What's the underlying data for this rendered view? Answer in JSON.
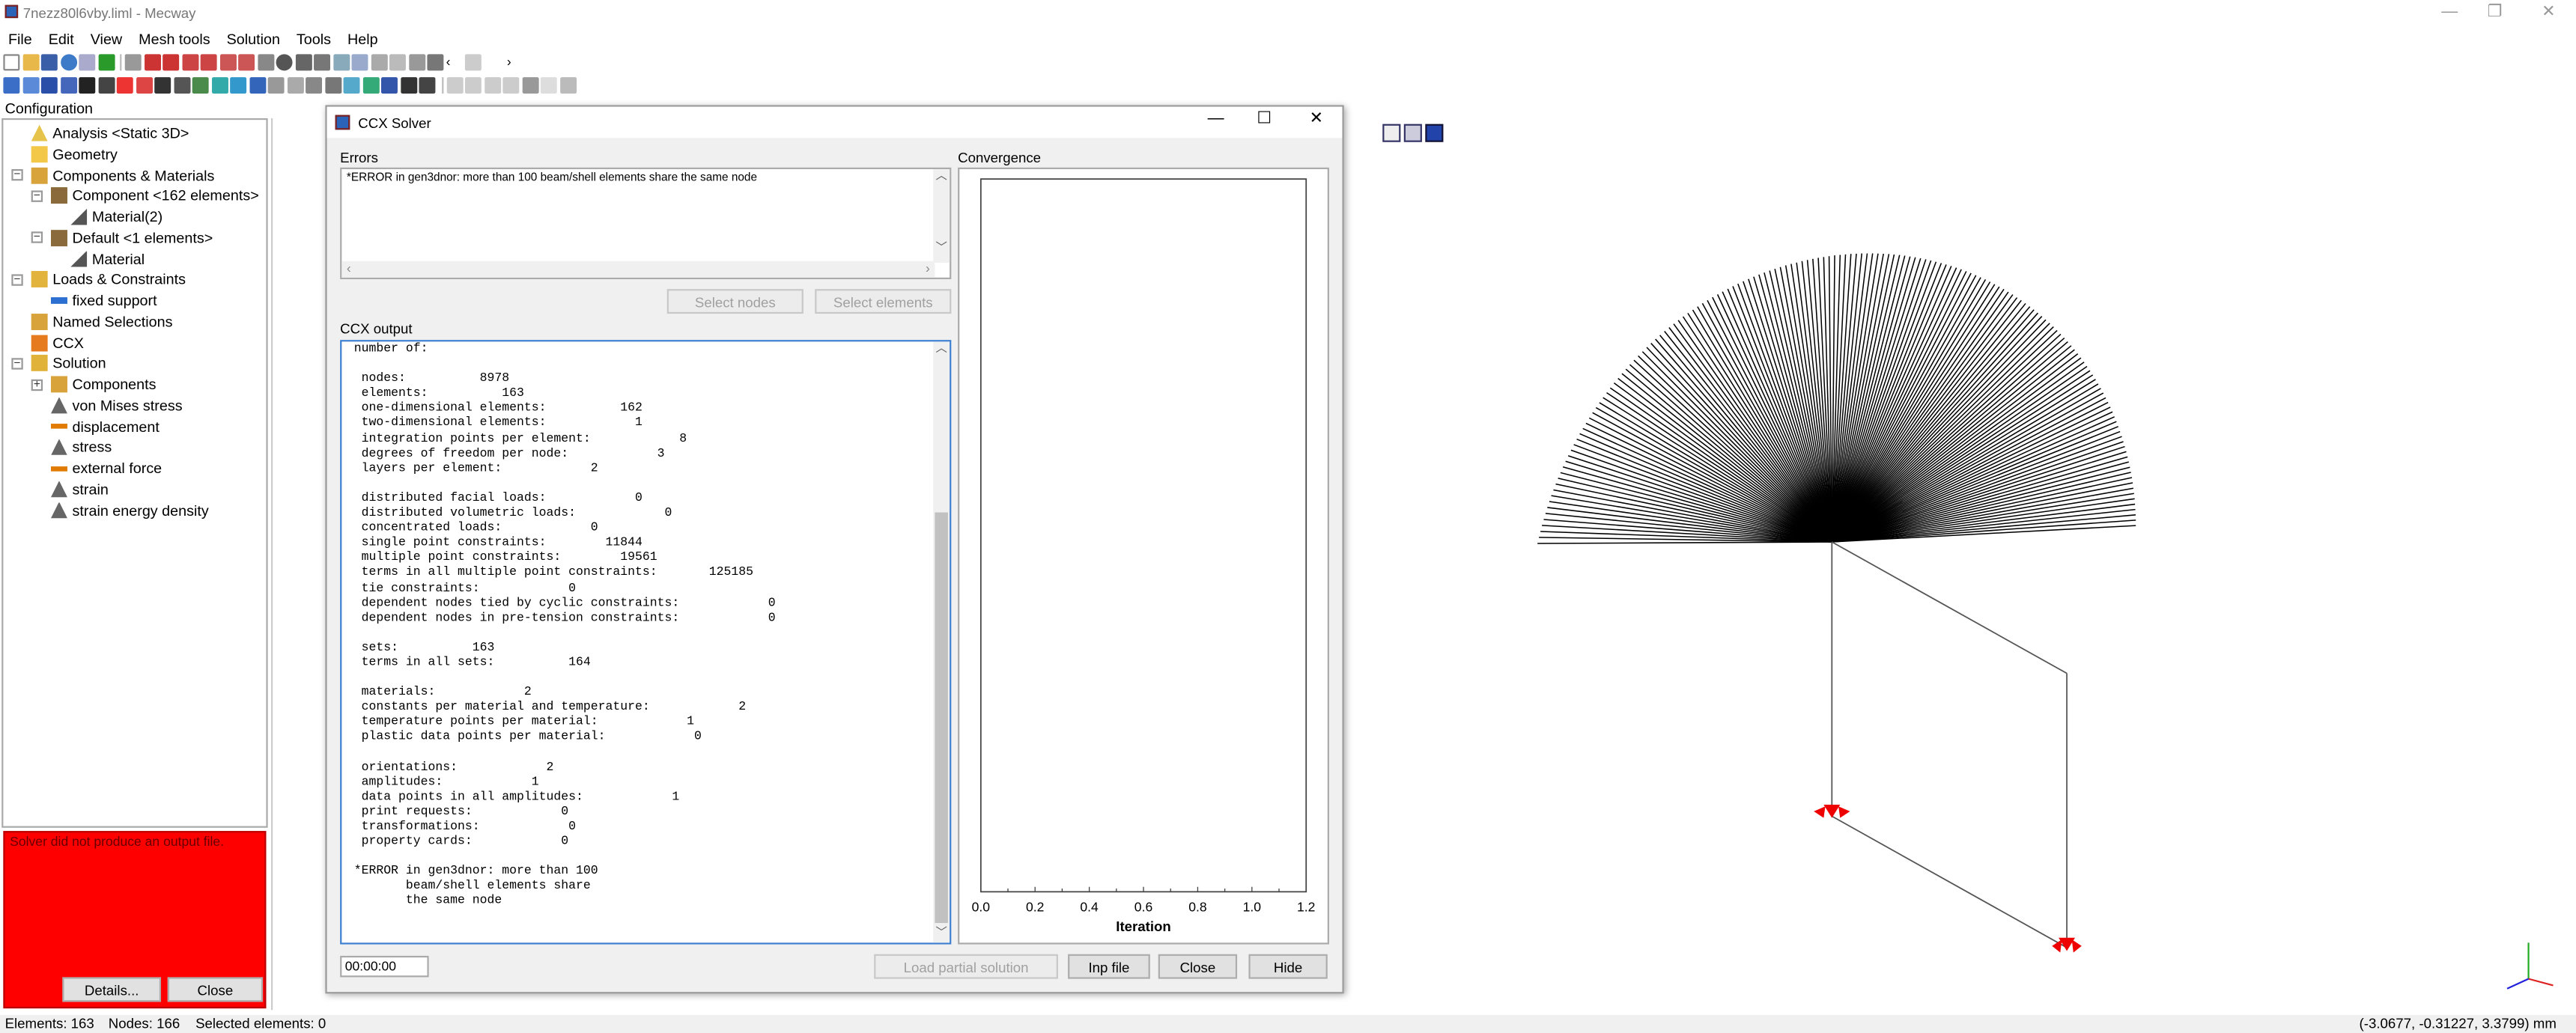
{
  "window": {
    "title": "7nezz80l6vby.liml - Mecway",
    "minimize": "—",
    "maximize": "❐",
    "close": "✕"
  },
  "menu": [
    "File",
    "Edit",
    "View",
    "Mesh tools",
    "Solution",
    "Tools",
    "Help"
  ],
  "config": {
    "title": "Configuration",
    "items": [
      {
        "label": "Analysis <Static 3D>",
        "icon": "analysis-icon"
      },
      {
        "label": "Geometry",
        "icon": "folder-icon"
      },
      {
        "label": "Components & Materials",
        "icon": "components-icon"
      },
      {
        "label": "Component <162 elements>",
        "icon": "component-icon"
      },
      {
        "label": "Material(2)",
        "icon": "material-icon"
      },
      {
        "label": "Default <1 elements>",
        "icon": "component-icon"
      },
      {
        "label": "Material",
        "icon": "material-icon"
      },
      {
        "label": "Loads & Constraints",
        "icon": "loads-icon"
      },
      {
        "label": "fixed support",
        "icon": "fixed-support-icon"
      },
      {
        "label": "Named Selections",
        "icon": "named-selections-icon"
      },
      {
        "label": "CCX",
        "icon": "ccx-icon"
      },
      {
        "label": "Solution",
        "icon": "solution-icon"
      },
      {
        "label": "Components",
        "icon": "components-icon"
      },
      {
        "label": "von Mises stress",
        "icon": "triangle-icon"
      },
      {
        "label": "displacement",
        "icon": "arrow-icon"
      },
      {
        "label": "stress",
        "icon": "triangle-icon"
      },
      {
        "label": "external force",
        "icon": "arrow-icon"
      },
      {
        "label": "strain",
        "icon": "triangle-icon"
      },
      {
        "label": "strain energy density",
        "icon": "triangle-icon"
      }
    ]
  },
  "error_panel": {
    "message": "Solver did not produce an output file.",
    "details_label": "Details...",
    "close_label": "Close"
  },
  "status": {
    "elements": "Elements: 163",
    "nodes": "Nodes: 166",
    "selected": "Selected elements: 0",
    "coords": "(-3.0677, -0.31227, 3.3799) mm"
  },
  "dialog": {
    "title": "CCX Solver",
    "errors_label": "Errors",
    "errors_text": "*ERROR in gen3dnor: more than 100 beam/shell elements share the same node",
    "select_nodes": "Select nodes",
    "select_elements": "Select elements",
    "output_label": "CCX output",
    "output_text": " number of:\n\n  nodes:          8978\n  elements:          163\n  one-dimensional elements:          162\n  two-dimensional elements:            1\n  integration points per element:            8\n  degrees of freedom per node:            3\n  layers per element:            2\n\n  distributed facial loads:            0\n  distributed volumetric loads:            0\n  concentrated loads:            0\n  single point constraints:        11844\n  multiple point constraints:        19561\n  terms in all multiple point constraints:       125185\n  tie constraints:            0\n  dependent nodes tied by cyclic constraints:            0\n  dependent nodes in pre-tension constraints:            0\n\n  sets:          163\n  terms in all sets:          164\n\n  materials:            2\n  constants per material and temperature:            2\n  temperature points per material:            1\n  plastic data points per material:            0\n\n  orientations:            2\n  amplitudes:            1\n  data points in all amplitudes:            1\n  print requests:            0\n  transformations:            0\n  property cards:            0\n\n *ERROR in gen3dnor: more than 100\n        beam/shell elements share\n        the same node",
    "timer": "00:00:00",
    "load_partial": "Load partial solution",
    "inp_file": "Inp file",
    "close": "Close",
    "hide": "Hide",
    "convergence_label": "Convergence",
    "x_ticks": [
      "0.0",
      "0.2",
      "0.4",
      "0.6",
      "0.8",
      "1.0",
      "1.2"
    ],
    "x_axis_label": "Iteration"
  },
  "chart_data": {
    "type": "line",
    "xlabel": "Iteration",
    "xlim": [
      0,
      1.2
    ],
    "x_ticks": [
      "0.0",
      "0.2",
      "0.4",
      "0.6",
      "0.8",
      "1.0",
      "1.2"
    ],
    "series": []
  }
}
